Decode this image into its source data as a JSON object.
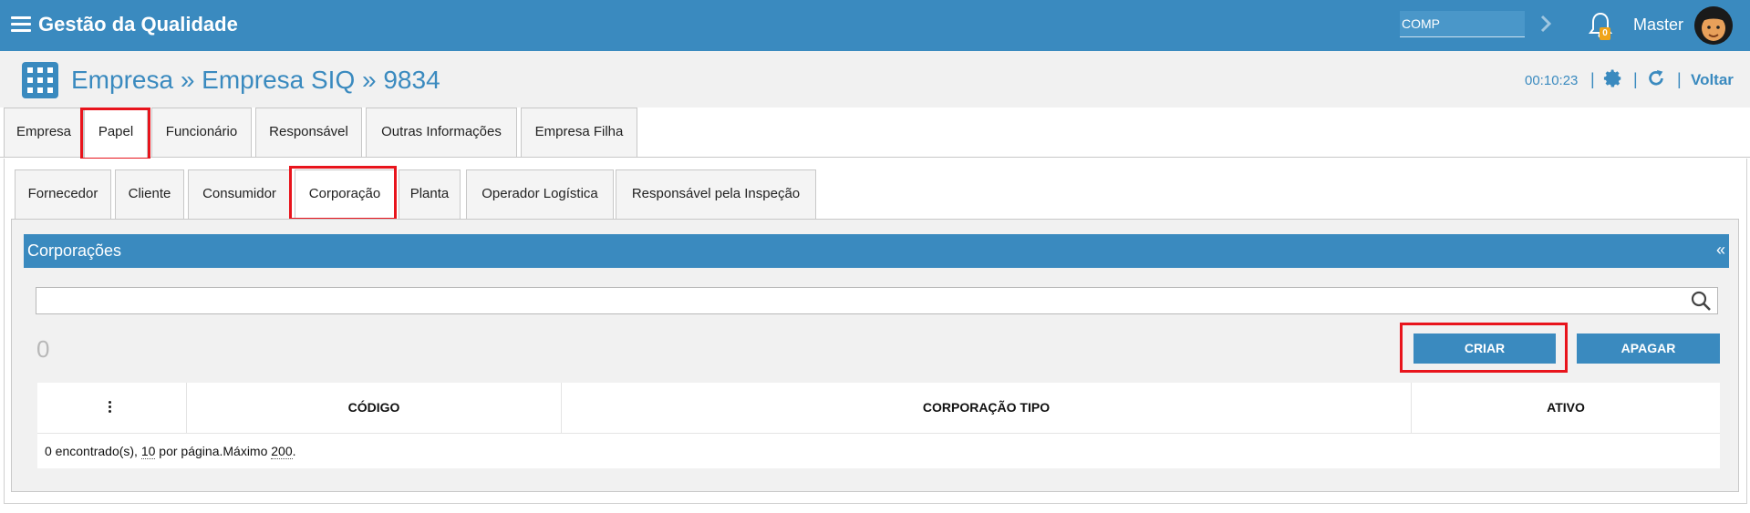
{
  "header": {
    "app_title": "Gestão da Qualidade",
    "company_field": "COMP",
    "notification_count": "0",
    "user_name": "Master"
  },
  "subheader": {
    "breadcrumb": "Empresa » Empresa SIQ » 9834",
    "timer": "00:10:23",
    "back_label": "Voltar"
  },
  "tabs_primary": [
    {
      "label": "Empresa"
    },
    {
      "label": "Papel"
    },
    {
      "label": "Funcionário"
    },
    {
      "label": "Responsável"
    },
    {
      "label": "Outras Informações"
    },
    {
      "label": "Empresa Filha"
    }
  ],
  "tabs_secondary": [
    {
      "label": "Fornecedor"
    },
    {
      "label": "Cliente"
    },
    {
      "label": "Consumidor"
    },
    {
      "label": "Corporação"
    },
    {
      "label": "Planta"
    },
    {
      "label": "Operador Logística"
    },
    {
      "label": "Responsável pela Inspeção"
    }
  ],
  "panel": {
    "title": "Corporações",
    "collapse_symbol": "«",
    "search_value": "",
    "count": "0",
    "create_label": "CRIAR",
    "delete_label": "APAGAR"
  },
  "table": {
    "columns": [
      "CÓDIGO",
      "CORPORAÇÃO TIPO",
      "ATIVO"
    ],
    "footer": {
      "found_text": "0 encontrado(s), ",
      "per_page_value": "10",
      "per_page_text": " por página.Máximo ",
      "max_value": "200",
      "end": "."
    }
  },
  "colors": {
    "primary": "#3a8abf",
    "highlight": "#e8141c",
    "badge": "#f0a418"
  }
}
